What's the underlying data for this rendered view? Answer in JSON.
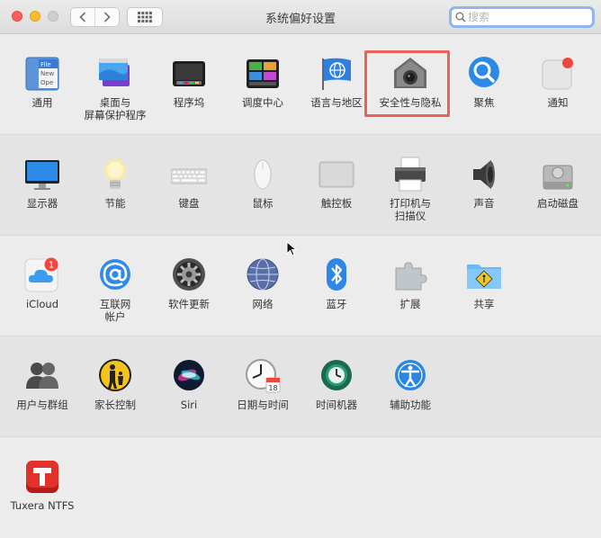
{
  "window": {
    "title": "系统偏好设置",
    "search_placeholder": "搜索"
  },
  "sections": [
    {
      "items": [
        {
          "label": "通用"
        },
        {
          "label": "桌面与\n屏幕保护程序"
        },
        {
          "label": "程序坞"
        },
        {
          "label": "调度中心"
        },
        {
          "label": "语言与地区"
        },
        {
          "label": "安全性与隐私"
        },
        {
          "label": "聚焦"
        },
        {
          "label": "通知"
        }
      ]
    },
    {
      "items": [
        {
          "label": "显示器"
        },
        {
          "label": "节能"
        },
        {
          "label": "键盘"
        },
        {
          "label": "鼠标"
        },
        {
          "label": "触控板"
        },
        {
          "label": "打印机与\n扫描仪"
        },
        {
          "label": "声音"
        },
        {
          "label": "启动磁盘"
        }
      ]
    },
    {
      "items": [
        {
          "label": "iCloud",
          "badge": "1"
        },
        {
          "label": "互联网\n帐户"
        },
        {
          "label": "软件更新"
        },
        {
          "label": "网络"
        },
        {
          "label": "蓝牙"
        },
        {
          "label": "扩展"
        },
        {
          "label": "共享"
        }
      ]
    },
    {
      "items": [
        {
          "label": "用户与群组"
        },
        {
          "label": "家长控制"
        },
        {
          "label": "Siri"
        },
        {
          "label": "日期与时间",
          "calendar_day": "18"
        },
        {
          "label": "时间机器"
        },
        {
          "label": "辅助功能"
        }
      ]
    },
    {
      "items": [
        {
          "label": "Tuxera NTFS"
        }
      ]
    }
  ],
  "general_icon_text": [
    "File",
    "New",
    "Ope"
  ],
  "colors": {
    "highlight": "#e8625a",
    "accent_blue": "#1f7ee8",
    "badge_red": "#f0473d"
  }
}
